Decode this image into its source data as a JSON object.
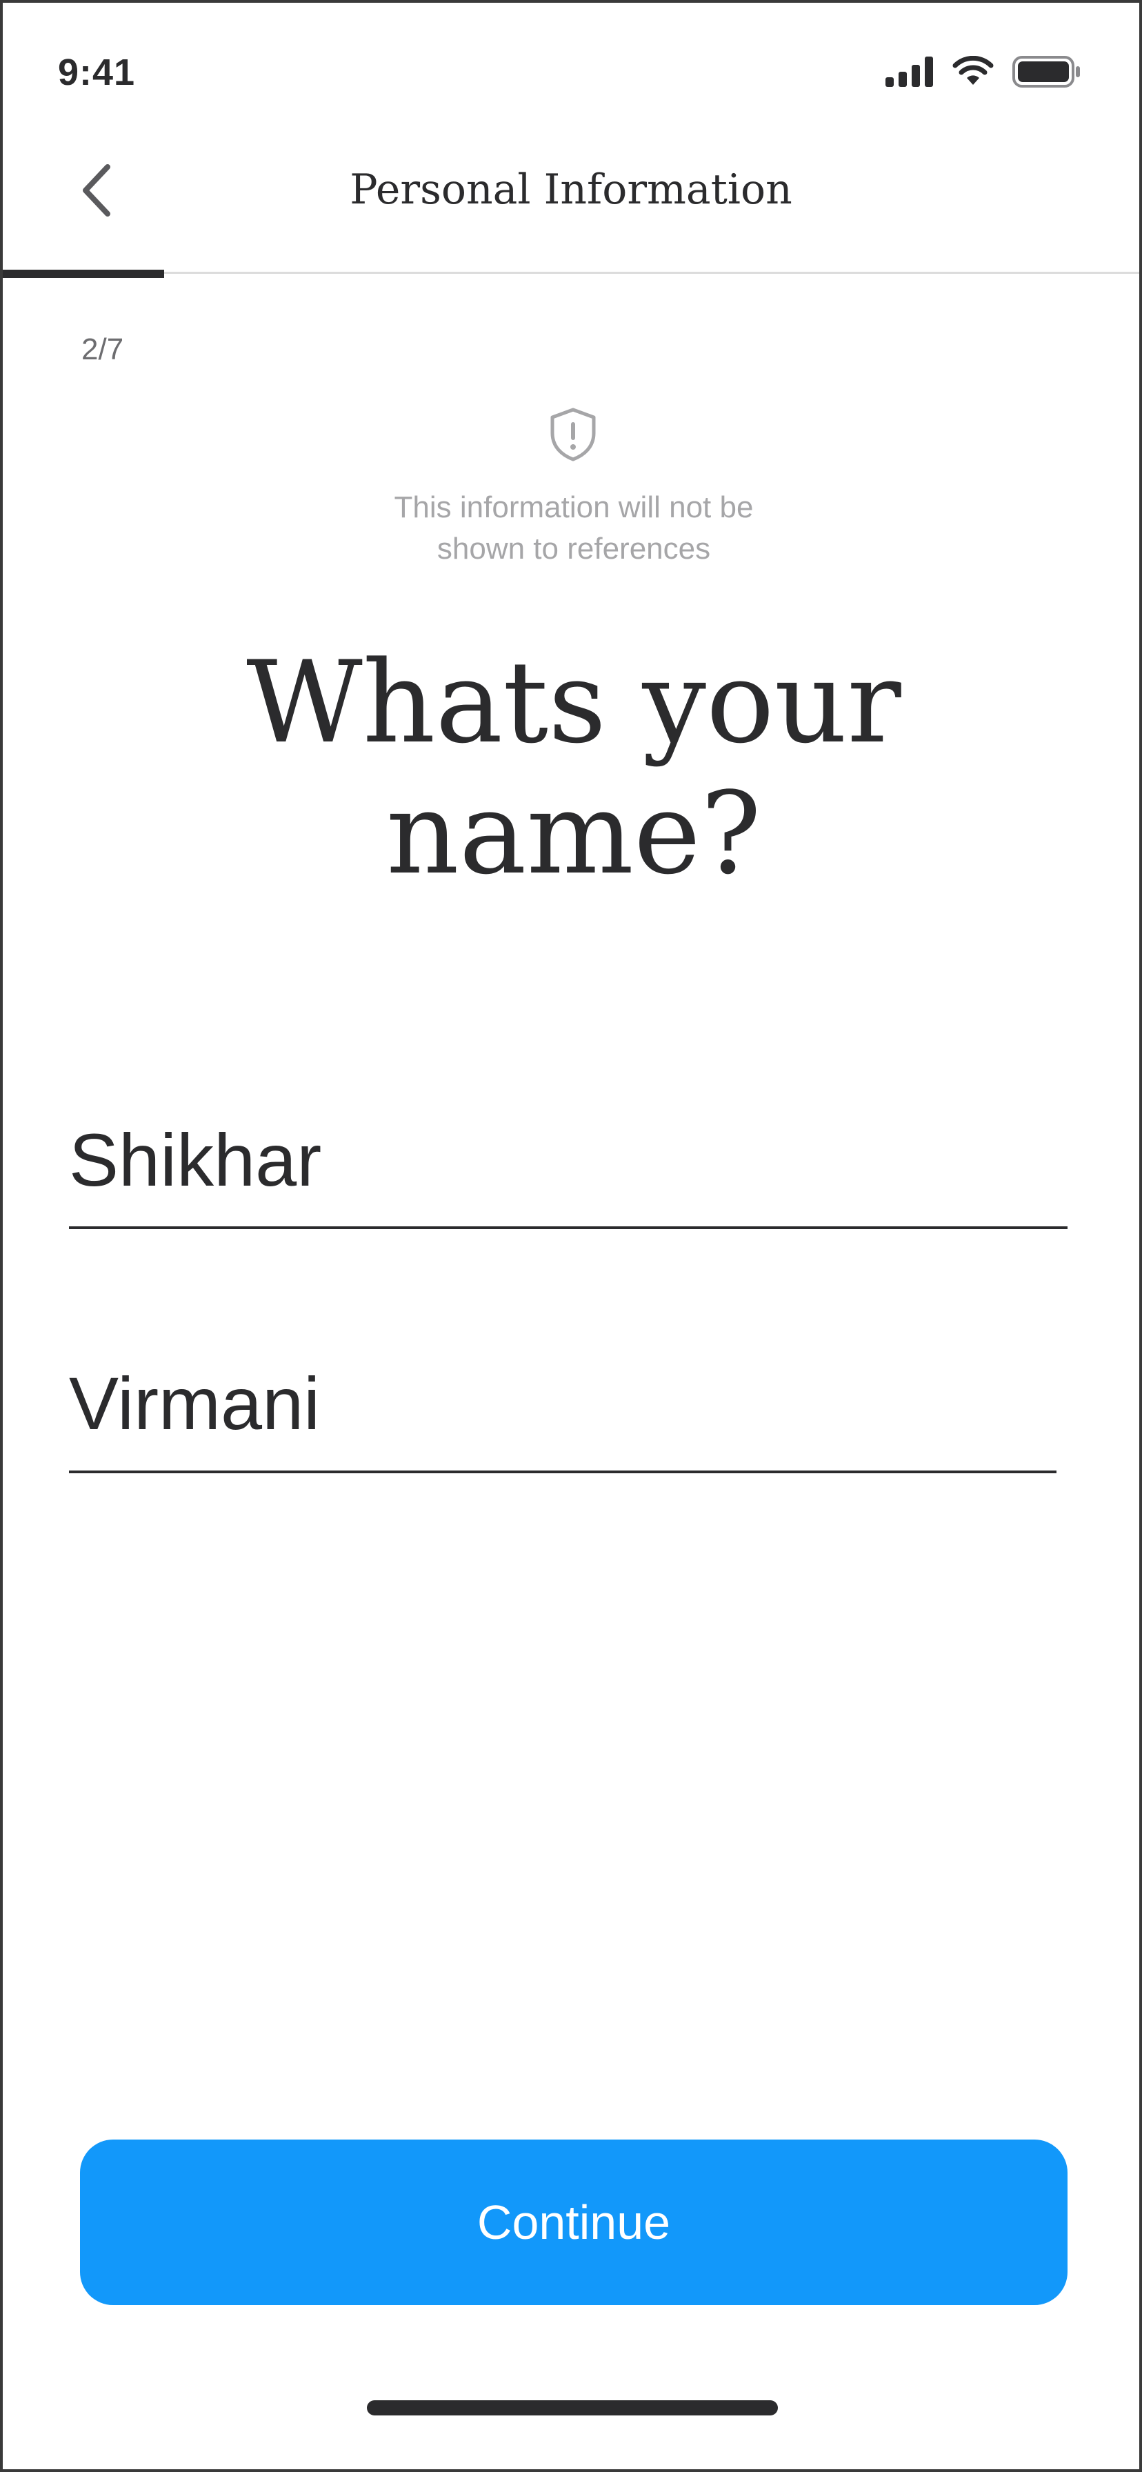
{
  "status_bar": {
    "time": "9:41",
    "icons": [
      "cellular-signal-icon",
      "wifi-icon",
      "battery-icon"
    ]
  },
  "header": {
    "title": "Personal Information",
    "back_icon": "chevron-left-icon",
    "progress_fraction": 0.142
  },
  "step": {
    "counter": "2/7"
  },
  "privacy": {
    "icon": "shield-alert-icon",
    "line1": "This information will not be",
    "line2": "shown to references"
  },
  "question": {
    "line1": "Whats your",
    "line2": "name?"
  },
  "form": {
    "first_name_value": "Shikhar",
    "last_name_value": "Virmani"
  },
  "actions": {
    "continue_label": "Continue"
  },
  "colors": {
    "accent": "#1298fa",
    "text": "#2b2b2d",
    "muted": "#a6a6a8"
  }
}
